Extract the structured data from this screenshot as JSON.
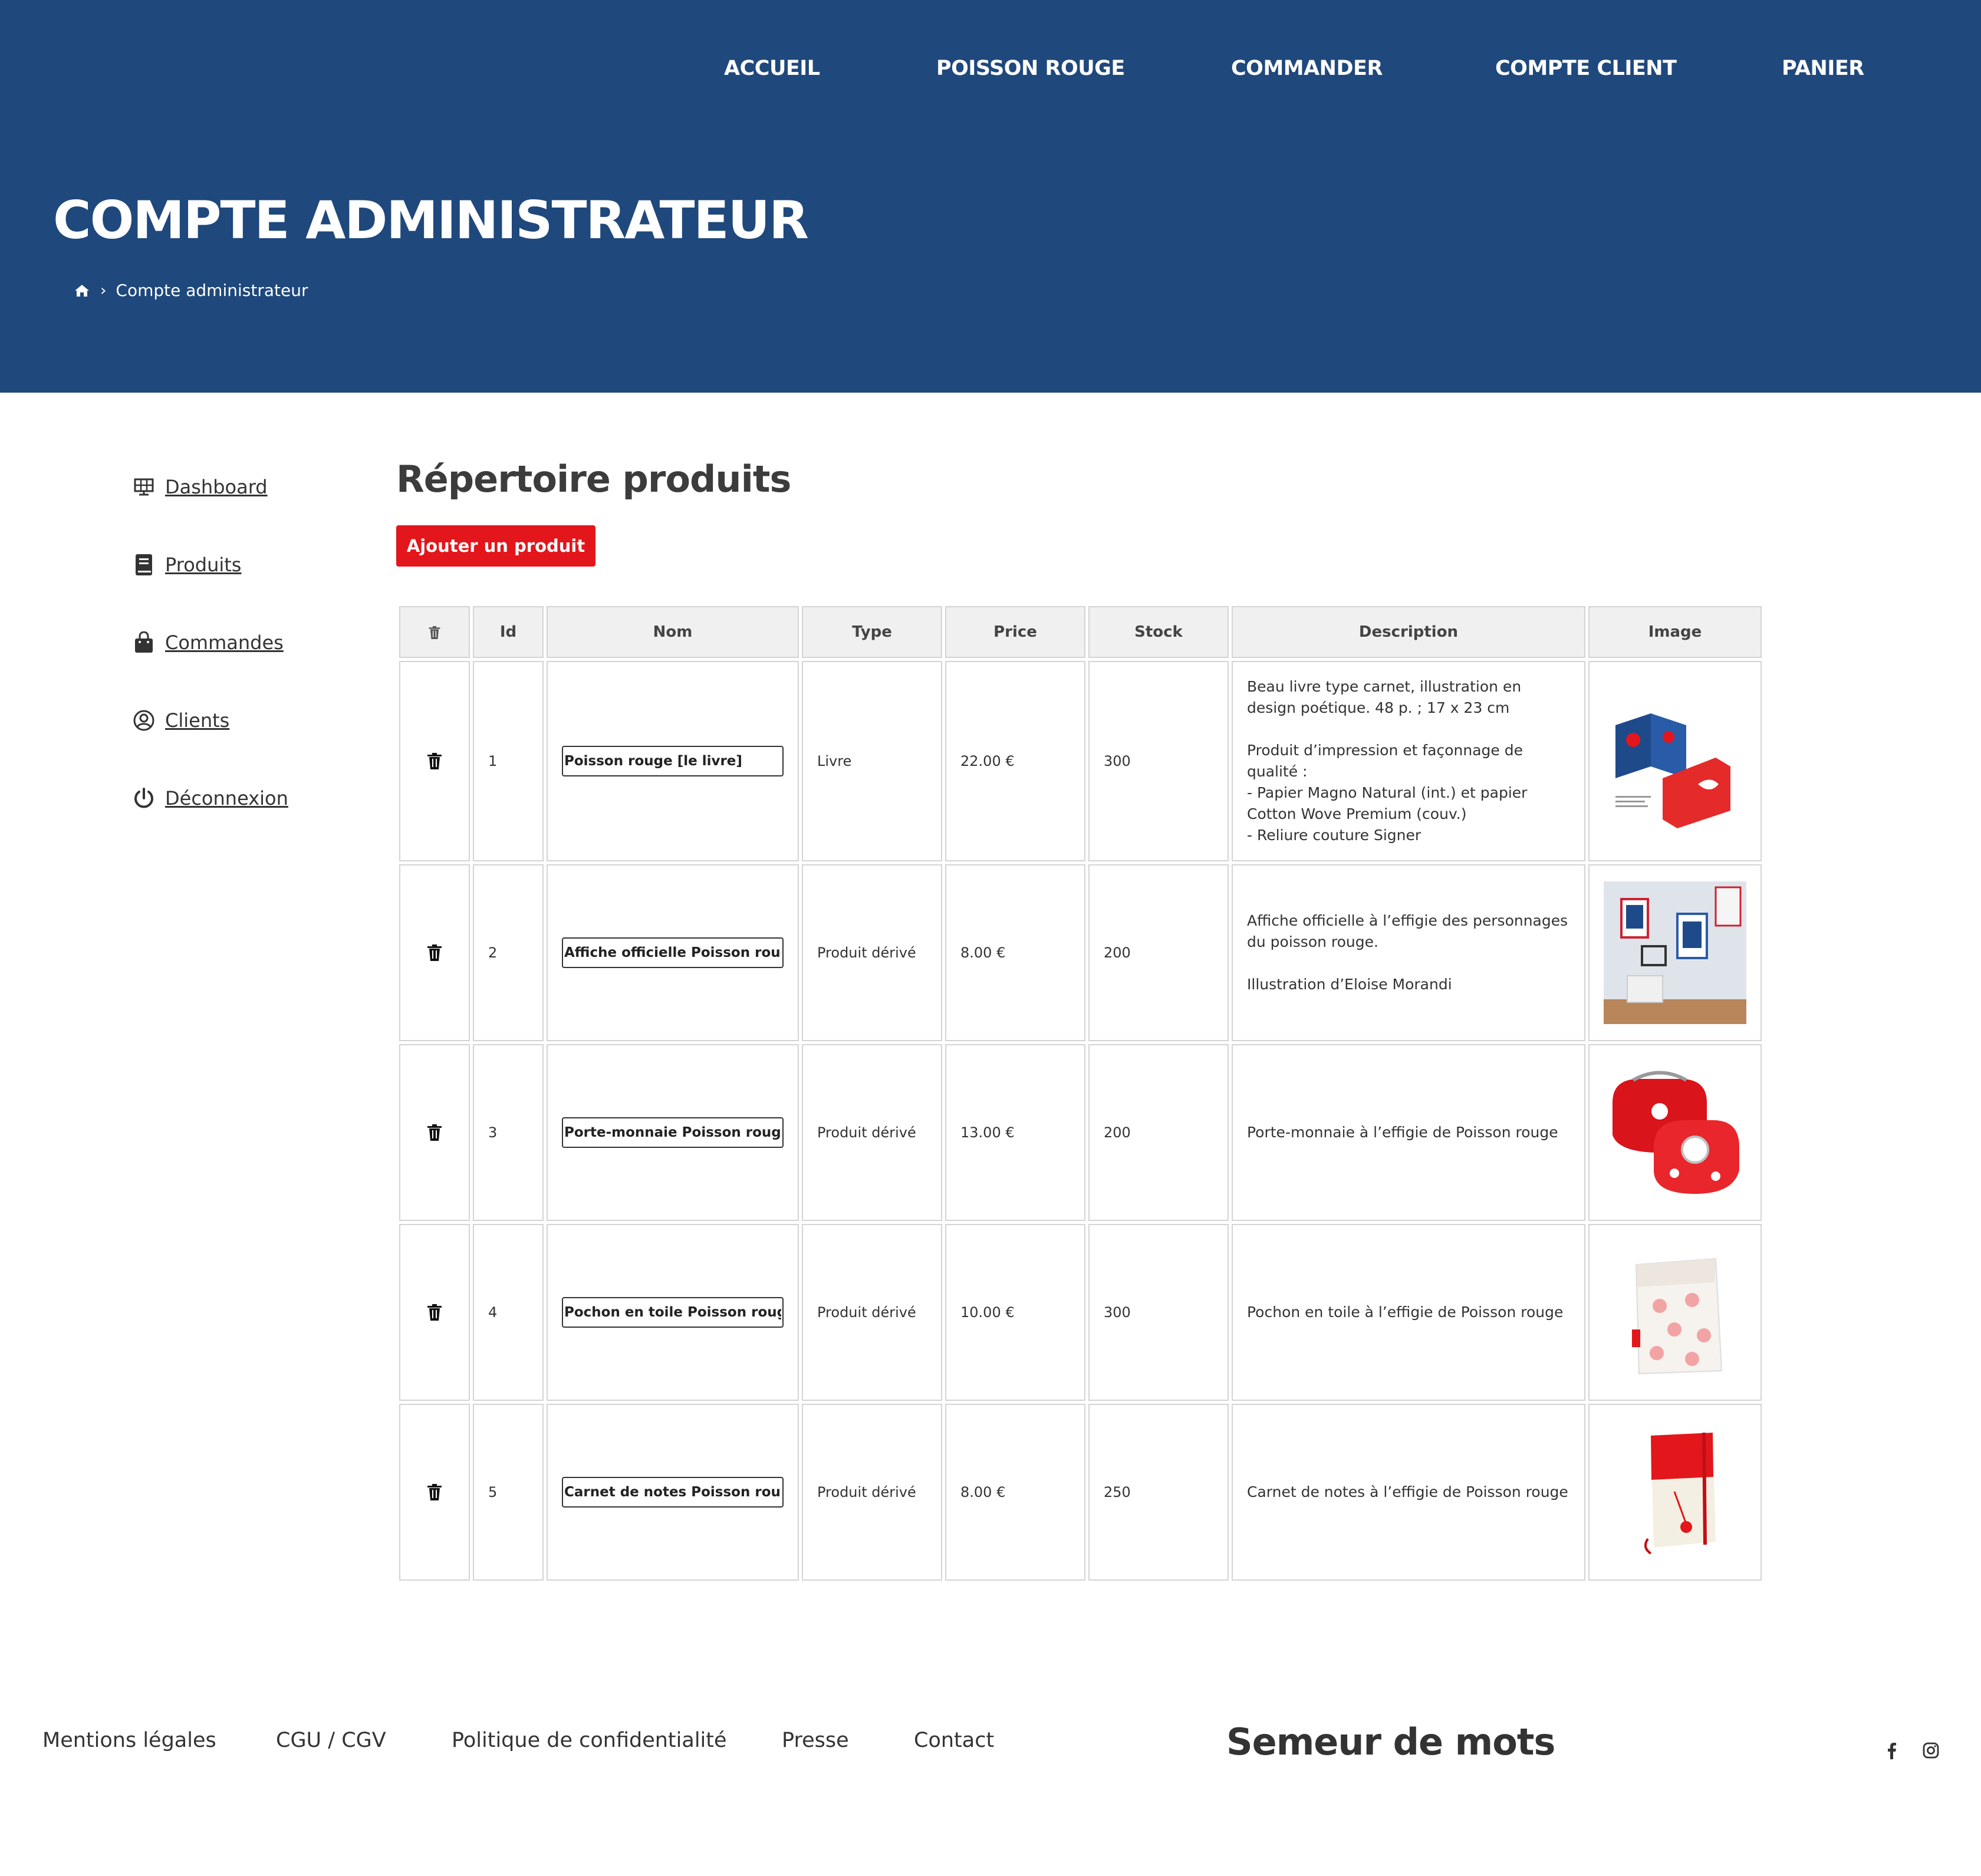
{
  "nav": {
    "items": [
      "ACCUEIL",
      "POISSON ROUGE",
      "COMMANDER",
      "COMPTE CLIENT",
      "PANIER"
    ]
  },
  "header": {
    "title": "COMPTE ADMINISTRATEUR",
    "breadcrumb_home_icon": "home-icon",
    "breadcrumb_separator": "›",
    "breadcrumb_current": "Compte administrateur"
  },
  "sidebar": {
    "items": [
      {
        "label": "Dashboard",
        "icon": "dashboard-icon"
      },
      {
        "label": "Produits",
        "icon": "book-icon"
      },
      {
        "label": "Commandes",
        "icon": "shopping-bag-icon"
      },
      {
        "label": "Clients",
        "icon": "user-circle-icon"
      },
      {
        "label": "Déconnexion",
        "icon": "power-icon"
      }
    ]
  },
  "main": {
    "title": "Répertoire produits",
    "add_button": "Ajouter un produit",
    "table": {
      "header_icon": "trash-icon",
      "columns": [
        "Id",
        "Nom",
        "Type",
        "Price",
        "Stock",
        "Description",
        "Image"
      ],
      "rows": [
        {
          "id": "1",
          "nom": "Poisson rouge [le livre]",
          "type": "Livre",
          "price": "22.00 €",
          "stock": "300",
          "description": "Beau livre type carnet, illustration en design poétique. 48 p. ; 17 x 23 cm\n\nProduit d’impression et façonnage de qualité :\n- Papier Magno Natural (int.) et papier Cotton Wove Premium (couv.)\n- Reliure couture Signer",
          "image": "book-photo"
        },
        {
          "id": "2",
          "nom": "Affiche officielle Poisson rouge",
          "type": "Produit dérivé",
          "price": "8.00 €",
          "stock": "200",
          "description": "Affiche officielle à l’effigie des personnages du poisson rouge.\n\nIllustration d’Eloise Morandi",
          "image": "poster-photo"
        },
        {
          "id": "3",
          "nom": "Porte-monnaie Poisson rouge",
          "type": "Produit dérivé",
          "price": "13.00 €",
          "stock": "200",
          "description": "Porte-monnaie à l’effigie de Poisson rouge",
          "image": "purse-photo"
        },
        {
          "id": "4",
          "nom": "Pochon en toile Poisson rouge",
          "type": "Produit dérivé",
          "price": "10.00 €",
          "stock": "300",
          "description": "Pochon en toile à l’effigie de Poisson rouge",
          "image": "pouch-photo"
        },
        {
          "id": "5",
          "nom": "Carnet de notes Poisson rouge",
          "type": "Produit dérivé",
          "price": "8.00 €",
          "stock": "250",
          "description": "Carnet de notes à l’effigie de Poisson rouge",
          "image": "notebook-photo"
        }
      ]
    }
  },
  "footer": {
    "links": [
      "Mentions légales",
      "CGU / CGV",
      "Politique de confidentialité",
      "Presse",
      "Contact"
    ],
    "brand": "Semeur de mots",
    "social_icons": [
      "facebook-icon",
      "instagram-icon"
    ]
  },
  "colors": {
    "header_bg": "#1f487c",
    "accent_button": "#e3161b",
    "text": "#333333",
    "table_border": "#d4d4d4",
    "table_header_bg": "#f0f0f0"
  }
}
